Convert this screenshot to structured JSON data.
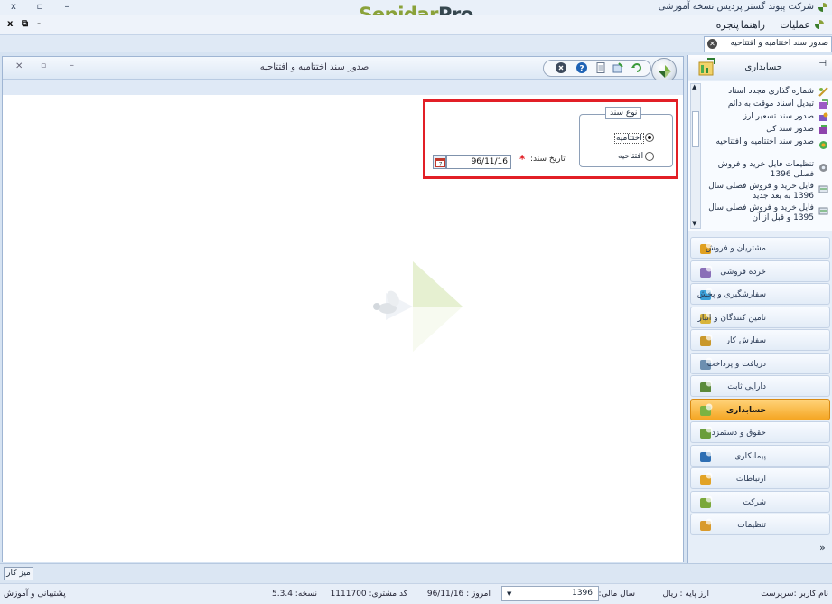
{
  "window": {
    "title": "شرکت پیوند گستر پردیس نسخه آموزشی",
    "brand_part1": "Sepidar",
    "brand_part2": "Pro",
    "close_glyph": "x",
    "maximize_glyph": "▫",
    "minimize_glyph": "–"
  },
  "menubar": {
    "items": [
      "عملیات",
      "راهنما",
      "پنجره"
    ],
    "mdi_close": "x",
    "mdi_restore": "⧉",
    "mdi_minimize": "-"
  },
  "tab": {
    "label": "صدور سند اختتامیه و افتتاحیه"
  },
  "form": {
    "title": "صدور سند اختتامیه و افتتاحیه",
    "group_title": "نوع سند",
    "radio_closing": "اختتامیه",
    "radio_opening": "افتتاحیه",
    "selected": "اختتامیه",
    "date_label": "تاریخ سند:",
    "required_marker": "*",
    "date_value": "96/11/16"
  },
  "nav": {
    "header": "حسابداری",
    "sub_items": [
      "شماره گذاری مجدد اسناد",
      "تبدیل اسناد موقت به دائم",
      "صدور سند تسعیر ارز",
      "صدور سند کل",
      "صدور سند اختتامیه و افتتاحیه",
      "تنظیمات فایل خرید و فروش فصلی 1396",
      "فایل خرید و فروش فصلی سال 1396 به بعد جدید",
      "فایل خرید و فروش فصلی سال 1395 و قبل از آن"
    ],
    "modules": [
      {
        "label": "مشتریان و فروش",
        "color": "#e0a020"
      },
      {
        "label": "خرده فروشی",
        "color": "#8a6fb8"
      },
      {
        "label": "سفارشگیری و پخش",
        "color": "#3aa0d8"
      },
      {
        "label": "تامین کنندگان و انبار",
        "color": "#d8b43a"
      },
      {
        "label": "سفارش کار",
        "color": "#c9982c"
      },
      {
        "label": "دریافت و پرداخت",
        "color": "#6c8fb0"
      },
      {
        "label": "دارایی ثابت",
        "color": "#5b8a3a"
      },
      {
        "label": "حسابداری",
        "color": "#7cb342"
      },
      {
        "label": "حقوق و دستمزد",
        "color": "#6a9e3c"
      },
      {
        "label": "پیمانکاری",
        "color": "#2f6fb3"
      },
      {
        "label": "ارتباطات",
        "color": "#e2a326"
      },
      {
        "label": "شرکت",
        "color": "#7aa83a"
      },
      {
        "label": "تنظیمات",
        "color": "#d99a2b"
      }
    ],
    "active_module": "حسابداری",
    "more_glyph": "»"
  },
  "taskbar": {
    "desk_label": "میز کار"
  },
  "status": {
    "user": "نام کاربر :سرپرست",
    "currency": "ارز پایه :  ریال",
    "fiscal_year_label": "سال مالی:",
    "fiscal_year": "1396",
    "today": "امروز :   96/11/16",
    "customer_code": "کد مشتری:  1111700",
    "version": "نسخه:   5.3.4",
    "support": "پشتیبانی و آموزش"
  },
  "colors": {
    "highlight": "#e21f26",
    "active_module": "#f5a623",
    "accent_green": "#8aa23a"
  }
}
